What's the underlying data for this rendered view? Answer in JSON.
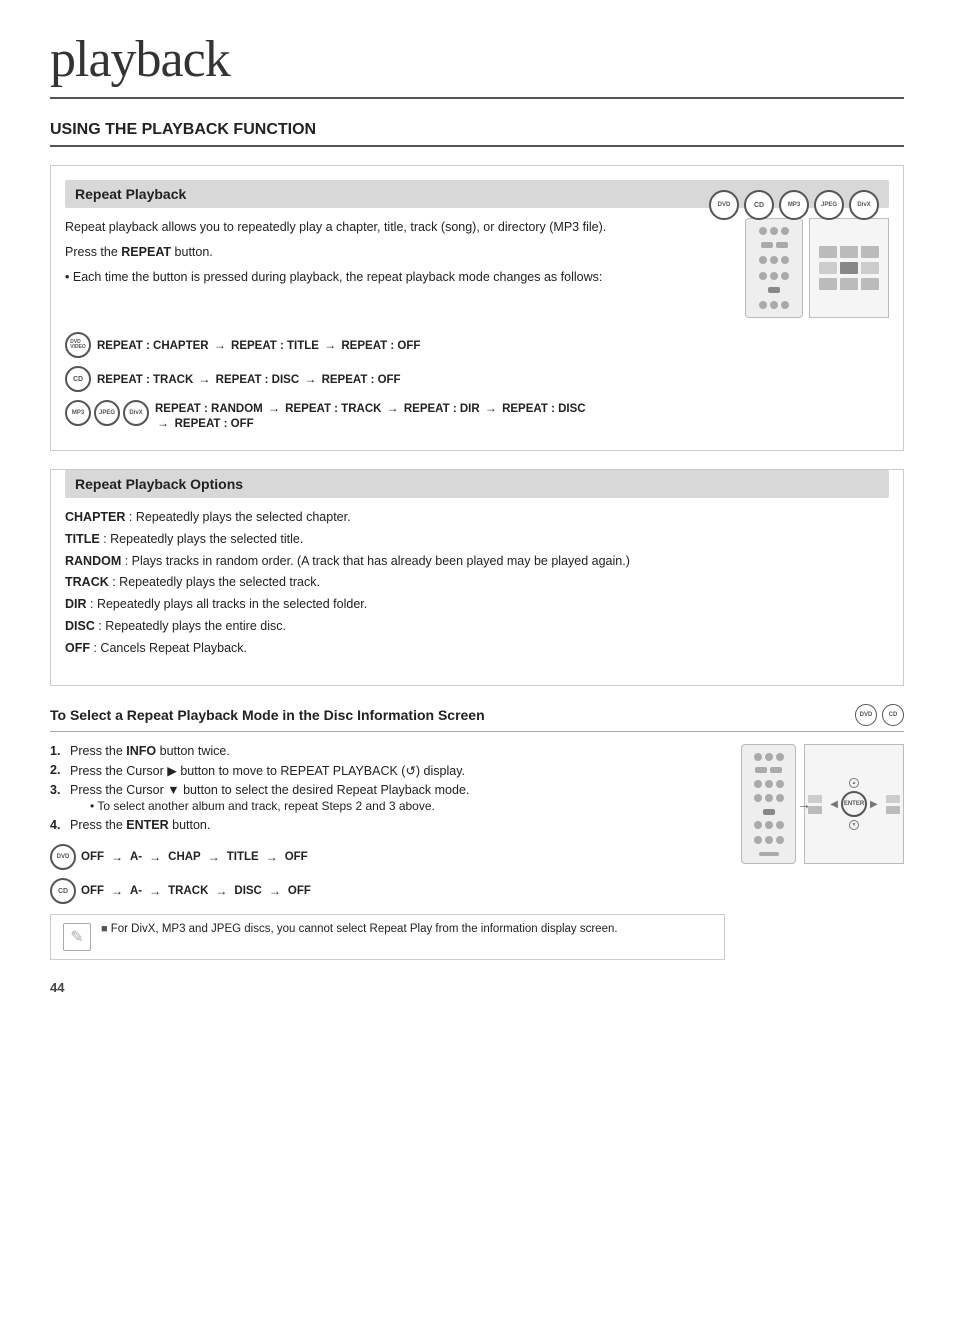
{
  "page": {
    "title": "playback",
    "page_number": "44"
  },
  "section": {
    "heading": "USING THE PLAYBACK FUNCTION"
  },
  "repeat_playback": {
    "title": "Repeat Playback",
    "description1": "Repeat playback allows you to repeatedly play a chapter, title, track (song), or directory (MP3 file).",
    "description2": "Press the REPEAT button.",
    "bullet": "Each time the button is pressed during playback, the repeat playback mode changes as follows:",
    "flow1": {
      "icon_label": "DVD VIDEO",
      "text": "REPEAT : CHAPTER → REPEAT : TITLE → REPEAT : OFF"
    },
    "flow2": {
      "icon_label": "CD",
      "text": "REPEAT : TRACK → REPEAT : DISC → REPEAT : OFF"
    },
    "flow3": {
      "icons": [
        "MP3",
        "JPEG",
        "DivX"
      ],
      "text": "REPEAT : RANDOM → REPEAT : TRACK → REPEAT : DIR → REPEAT : DISC → REPEAT : OFF"
    }
  },
  "repeat_options": {
    "title": "Repeat Playback Options",
    "options": [
      {
        "key": "CHAPTER",
        "value": ": Repeatedly plays the selected chapter."
      },
      {
        "key": "TITLE",
        "value": ": Repeatedly plays the selected title."
      },
      {
        "key": "RANDOM",
        "value": ": Plays tracks in random order. (A track that has already been played may be played again.)"
      },
      {
        "key": "TRACK",
        "value": ": Repeatedly plays the selected track."
      },
      {
        "key": "DIR",
        "value": ": Repeatedly plays all tracks in the selected folder."
      },
      {
        "key": "DISC",
        "value": ": Repeatedly plays the entire disc."
      },
      {
        "key": "OFF",
        "value": ": Cancels Repeat Playback."
      }
    ]
  },
  "disc_info_section": {
    "title": "To Select a Repeat Playback Mode in the Disc Information Screen",
    "icons": [
      "DVD",
      "CD"
    ],
    "steps": [
      {
        "num": "1.",
        "text": "Press the INFO button twice."
      },
      {
        "num": "2.",
        "text": "Press the Cursor ▶ button to move to REPEAT PLAYBACK (↺) display."
      },
      {
        "num": "3.",
        "text": "Press the Cursor ▼ button to select the desired Repeat Playback mode.",
        "sub": "• To select another album and track, repeat Steps 2 and 3 above."
      },
      {
        "num": "4.",
        "text": "Press the ENTER button."
      }
    ],
    "flow_dvd": "OFF → A- → CHAP → TITLE → OFF",
    "flow_cd": "OFF → A- → TRACK → DISC → OFF",
    "note": "For DivX, MP3 and JPEG discs, you cannot select Repeat Play from the information display screen."
  }
}
